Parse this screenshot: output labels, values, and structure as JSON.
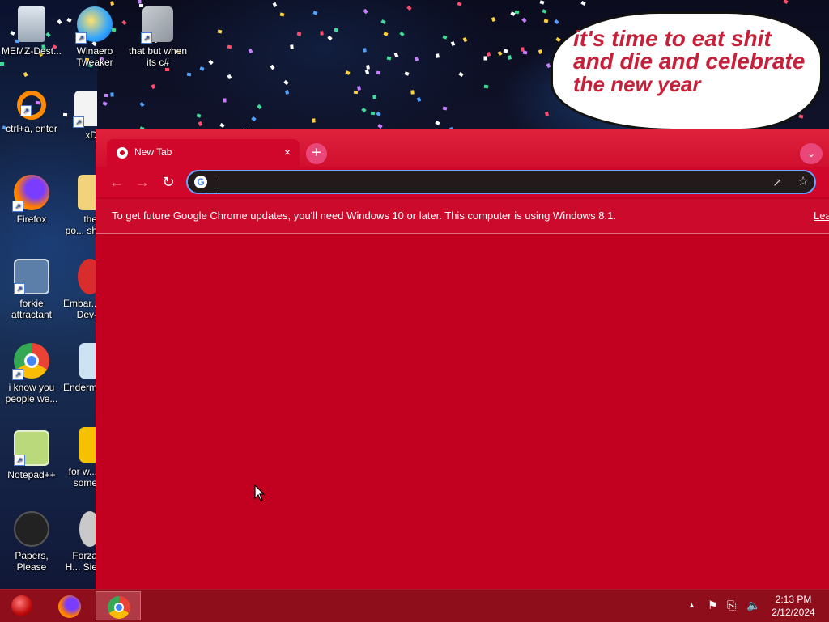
{
  "desktop": {
    "bubble_lines": [
      "it's time to eat shit",
      "and die and celebrate",
      "the new year"
    ],
    "icons": [
      {
        "label": "MEMZ-Dest...",
        "icon": "recycle-bin-icon"
      },
      {
        "label": "Winaero Tweaker",
        "icon": "winaero-icon"
      },
      {
        "label": "that but when its c#",
        "icon": "windows-stack-icon"
      },
      {
        "label": "ctrl+a, enter",
        "icon": "ring-icon"
      },
      {
        "label": "xD",
        "icon": "hxd-icon"
      },
      {
        "label": "Firefox",
        "icon": "firefox-icon"
      },
      {
        "label": "the po... sh",
        "icon": "folder-icon"
      },
      {
        "label": "forkie attractant",
        "icon": "gear-monitor-icon"
      },
      {
        "label": "Embar... Dev-",
        "icon": "dev-icon"
      },
      {
        "label": "i know you people we...",
        "icon": "chrome-icon"
      },
      {
        "label": "Enderm...",
        "icon": "monitor-icon"
      },
      {
        "label": "Notepad++",
        "icon": "notepadpp-icon"
      },
      {
        "label": "for w... some",
        "icon": "yellow-app-icon"
      },
      {
        "label": "Papers, Please",
        "icon": "papers-please-icon"
      },
      {
        "label": "Forza H... Sie",
        "icon": "forza-icon"
      }
    ]
  },
  "chrome": {
    "tab_title": "New Tab",
    "tab_close": "×",
    "new_tab": "+",
    "omnibox_value": "",
    "infobar_text": "To get future Google Chrome updates, you'll need Windows 10 or later. This computer is using Windows 8.1.",
    "infobar_link": "Lea",
    "theme_color": "#c2001f"
  },
  "taskbar": {
    "apps": [
      "firefox-icon",
      "chrome-icon"
    ],
    "time": "2:13 PM",
    "date": "2/12/2024"
  }
}
